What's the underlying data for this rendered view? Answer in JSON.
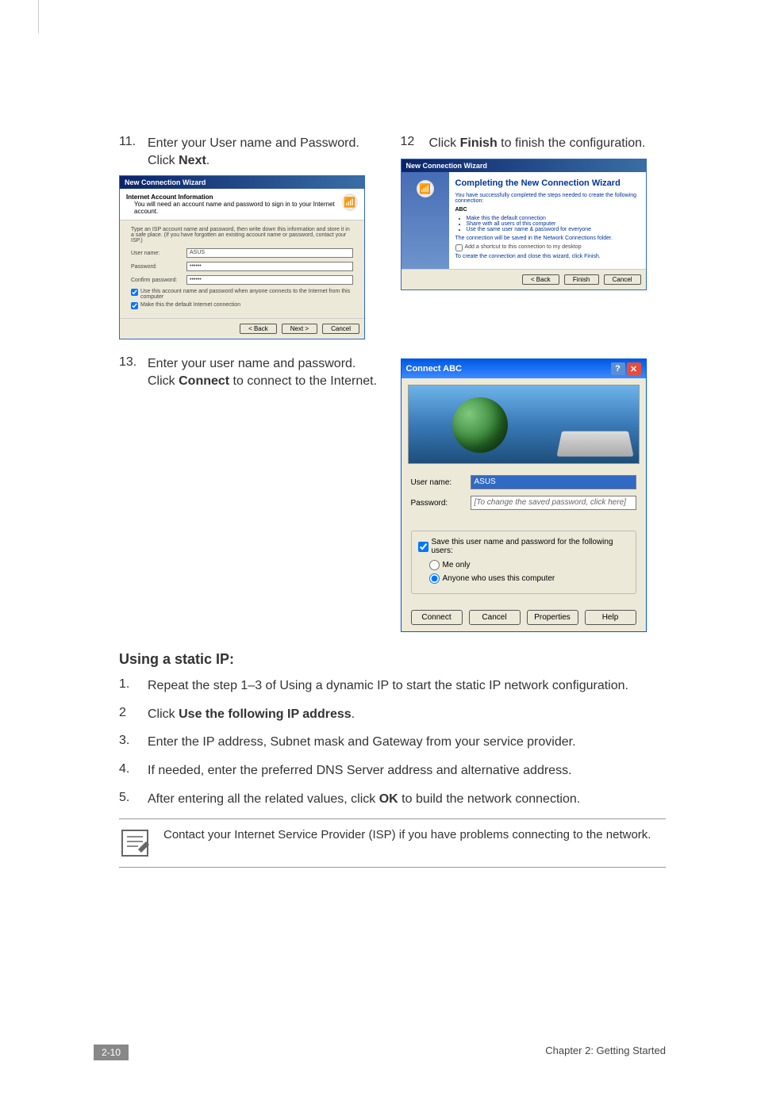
{
  "steps": {
    "s11": {
      "num": "11.",
      "text_a": "Enter your User name and Password. Click ",
      "bold": "Next",
      "text_b": "."
    },
    "s12": {
      "num": "12",
      "text_a": "Click ",
      "bold": "Finish",
      "text_b": " to finish the configuration."
    },
    "s13": {
      "num": "13.",
      "text_a": "Enter your user name and password. Click ",
      "bold": "Connect",
      "text_b": " to connect to the Internet."
    }
  },
  "wizard11": {
    "title": "New Connection Wizard",
    "header_bold": "Internet Account Information",
    "header_sub": "You will need an account name and password to sign in to your Internet account.",
    "body_intro": "Type an ISP account name and password, then write down this information and store it in a safe place. (If you have forgotten an existing account name or password, contact your ISP.)",
    "user_label": "User name:",
    "user_value": "ASUS",
    "pass_label": "Password:",
    "pass_value": "••••••",
    "confirm_label": "Confirm password:",
    "confirm_value": "••••••",
    "chk1": "Use this account name and password when anyone connects to the Internet from this computer",
    "chk2": "Make this the default Internet connection",
    "btn_back": "< Back",
    "btn_next": "Next >",
    "btn_cancel": "Cancel"
  },
  "wizard12": {
    "title": "New Connection Wizard",
    "heading": "Completing the New Connection Wizard",
    "p1": "You have successfully completed the steps needed to create the following connection:",
    "abc": "ABC",
    "bullets": [
      "Make this the default connection",
      "Share with all users of this computer",
      "Use the same user name & password for everyone"
    ],
    "p2": "The connection will be saved in the Network Connections folder.",
    "chk": "Add a shortcut to this connection to my desktop",
    "p3": "To create the connection and close this wizard, click Finish.",
    "btn_back": "< Back",
    "btn_finish": "Finish",
    "btn_cancel": "Cancel"
  },
  "connect": {
    "title": "Connect ABC",
    "user_label": "User name:",
    "user_value": "ASUS",
    "pass_label": "Password:",
    "pass_value": "[To change the saved password, click here]",
    "save_chk": "Save this user name and password for the following users:",
    "radio1": "Me only",
    "radio2": "Anyone who uses this computer",
    "btn_connect": "Connect",
    "btn_cancel": "Cancel",
    "btn_props": "Properties",
    "btn_help": "Help"
  },
  "static": {
    "heading": "Using a static IP:",
    "items": [
      {
        "num": "1.",
        "text": "Repeat the step 1–3 of Using a dynamic IP to start the static IP network configuration."
      },
      {
        "num": "2",
        "pre": "Click ",
        "bold": "Use the following IP address",
        "post": "."
      },
      {
        "num": "3.",
        "text": "Enter the IP address, Subnet mask and Gateway from your service provider."
      },
      {
        "num": "4.",
        "text": "If needed, enter the preferred DNS Server address and alternative address."
      },
      {
        "num": "5.",
        "pre": "After entering all the related values, click ",
        "bold": "OK",
        "post": " to build the network connection."
      }
    ]
  },
  "note": "Contact your Internet Service Provider (ISP) if you have problems connecting to the network.",
  "footer": {
    "page": "2-10",
    "chapter": "Chapter 2: Getting Started"
  }
}
